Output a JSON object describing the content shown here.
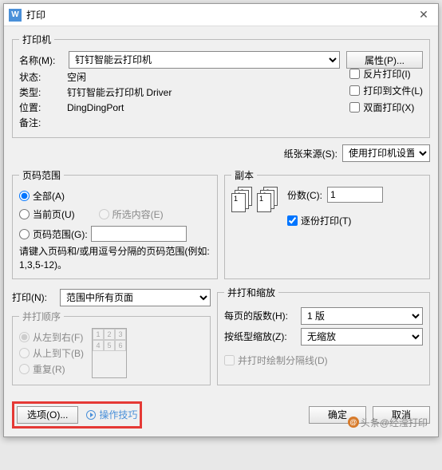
{
  "title": "打印",
  "printer": {
    "group": "打印机",
    "name_label": "名称(M):",
    "name_value": "钉钉智能云打印机",
    "props_btn": "属性(P)...",
    "status_label": "状态:",
    "status_value": "空闲",
    "type_label": "类型:",
    "type_value": "钉钉智能云打印机 Driver",
    "where_label": "位置:",
    "where_value": "DingDingPort",
    "comment_label": "备注:",
    "reverse": "反片打印(I)",
    "tofile": "打印到文件(L)",
    "duplex": "双面打印(X)"
  },
  "paper": {
    "source_label": "纸张来源(S):",
    "source_value": "使用打印机设置"
  },
  "range": {
    "group": "页码范围",
    "all": "全部(A)",
    "current": "当前页(U)",
    "selection": "所选内容(E)",
    "pages": "页码范围(G):",
    "hint": "请键入页码和/或用逗号分隔的页码范围(例如: 1,3,5-12)。"
  },
  "copies": {
    "group": "副本",
    "count_label": "份数(C):",
    "count_value": "1",
    "collate": "逐份打印(T)"
  },
  "printwhat": {
    "label": "打印(N):",
    "value": "范围中所有页面"
  },
  "order": {
    "group": "并打顺序",
    "lr": "从左到右(F)",
    "tb": "从上到下(B)",
    "repeat": "重复(R)"
  },
  "scale": {
    "group": "并打和缩放",
    "per_label": "每页的版数(H):",
    "per_value": "1 版",
    "fit_label": "按纸型缩放(Z):",
    "fit_value": "无缩放",
    "sep": "并打时绘制分隔线(D)"
  },
  "footer": {
    "options": "选项(O)...",
    "tips": "操作技巧",
    "ok": "确定",
    "cancel": "取消"
  },
  "watermark": "头条@经滢打印"
}
